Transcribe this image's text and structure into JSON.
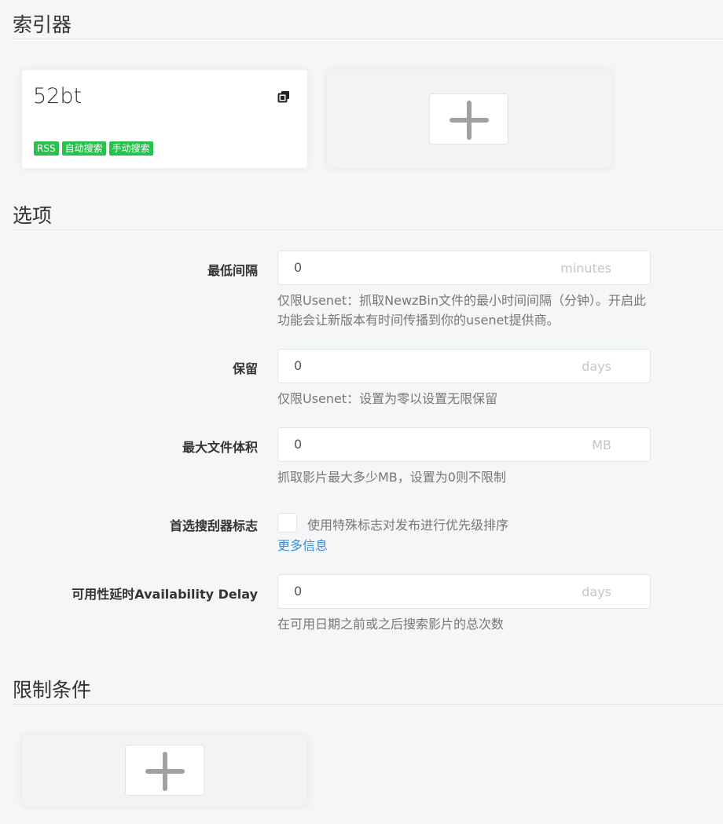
{
  "sections": {
    "indexers": "索引器",
    "options": "选项",
    "restrictions": "限制条件"
  },
  "indexer": {
    "name": "52bt",
    "tags": [
      "RSS",
      "自动搜索",
      "手动搜索"
    ],
    "tag_color": "#27c24c"
  },
  "options": {
    "min_interval": {
      "label": "最低间隔",
      "value": "0",
      "unit": "minutes",
      "help": "仅限Usenet：抓取NewzBin文件的最小时间间隔（分钟）。开启此功能会让新版本有时间传播到你的usenet提供商。"
    },
    "retention": {
      "label": "保留",
      "value": "0",
      "unit": "days",
      "help": "仅限Usenet：设置为零以设置无限保留"
    },
    "max_size": {
      "label": "最大文件体积",
      "value": "0",
      "unit": "MB",
      "help": "抓取影片最大多少MB，设置为0则不限制"
    },
    "prefer_flags": {
      "label": "首选搜刮器标志",
      "checkbox_label": "使用特殊标志对发布进行优先级排序",
      "more_info": "更多信息"
    },
    "availability_delay": {
      "label": "可用性延时Availability Delay",
      "value": "0",
      "unit": "days",
      "help": "在可用日期之前或之后搜索影片的总次数"
    }
  },
  "colors": {
    "link": "#3a8dd4",
    "background": "#f5f6f8"
  }
}
